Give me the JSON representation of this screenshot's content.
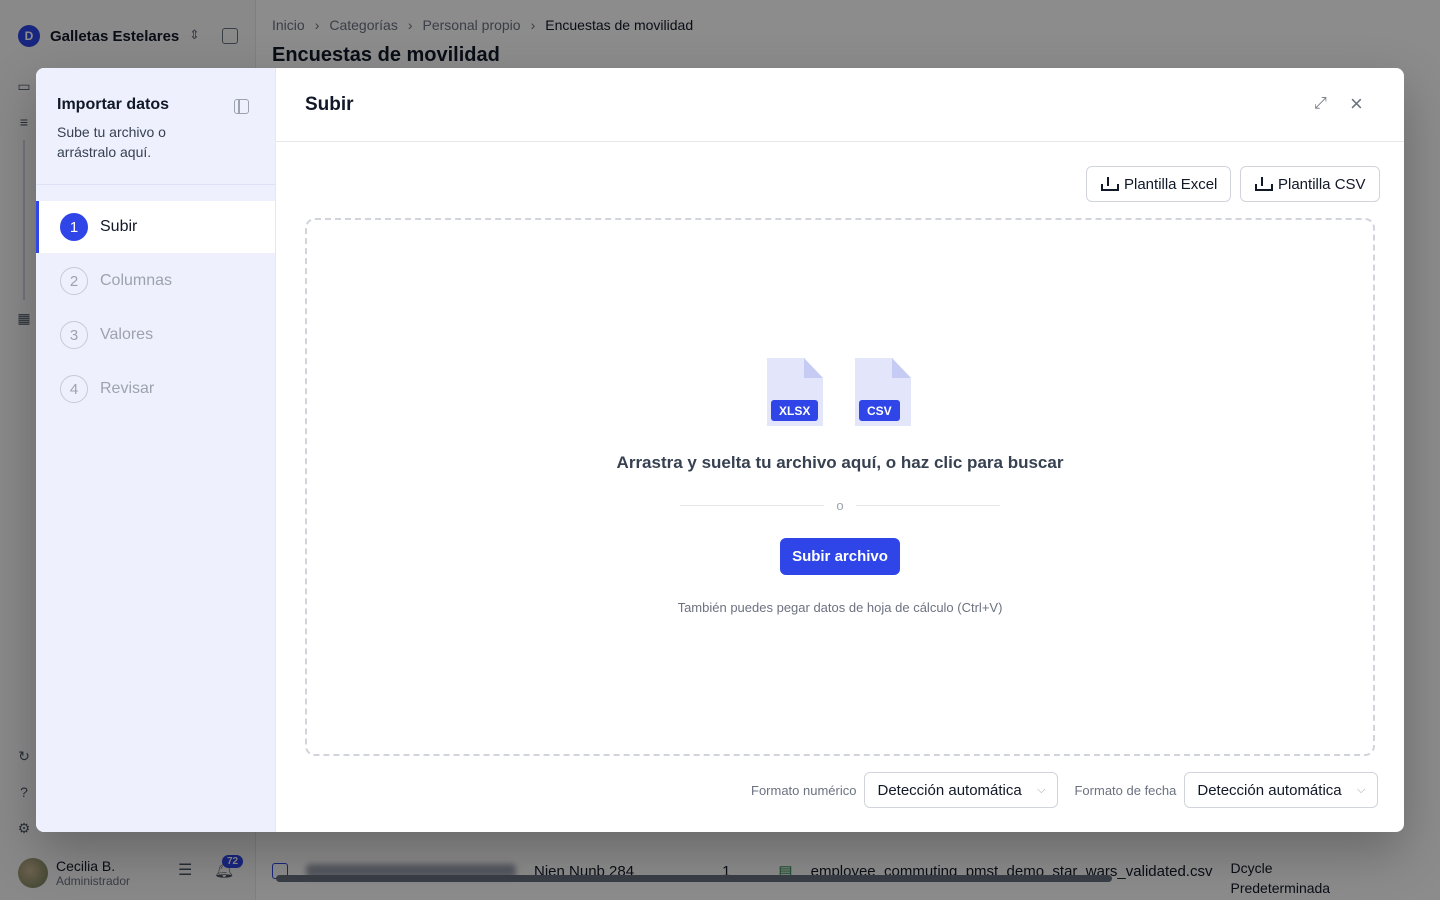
{
  "background": {
    "org_name": "Galletas Estelares",
    "org_initial": "D",
    "breadcrumb": [
      "Inicio",
      "Categorías",
      "Personal propio",
      "Encuestas de movilidad"
    ],
    "page_title": "Encuestas de movilidad",
    "user": {
      "name": "Cecilia B.",
      "role": "Administrador",
      "notifications": "72"
    },
    "row": {
      "location": "Nien Nunb 284",
      "count": "1",
      "file": "employee_commuting_pmst_demo_star_wars_validated.csv",
      "category_line1": "Dcycle",
      "category_line2": "Predeterminada"
    }
  },
  "modal": {
    "sidebar": {
      "title": "Importar datos",
      "subtitle": "Sube tu archivo o arrástralo aquí.",
      "steps": [
        {
          "num": "1",
          "label": "Subir"
        },
        {
          "num": "2",
          "label": "Columnas"
        },
        {
          "num": "3",
          "label": "Valores"
        },
        {
          "num": "4",
          "label": "Revisar"
        }
      ]
    },
    "title": "Subir",
    "template_excel": "Plantilla Excel",
    "template_csv": "Plantilla CSV",
    "dropzone": {
      "file_types": [
        "XLSX",
        "CSV"
      ],
      "text": "Arrastra y suelta tu archivo aquí, o haz clic para buscar",
      "or": "o",
      "upload_button": "Subir archivo",
      "paste_hint": "También puedes pegar datos de hoja de cálculo (Ctrl+V)"
    },
    "number_format": {
      "label": "Formato numérico",
      "value": "Detección automática"
    },
    "date_format": {
      "label": "Formato de fecha",
      "value": "Detección automática"
    }
  },
  "colors": {
    "accent": "#2f45e8",
    "sidebar_bg": "#eef0fd"
  }
}
